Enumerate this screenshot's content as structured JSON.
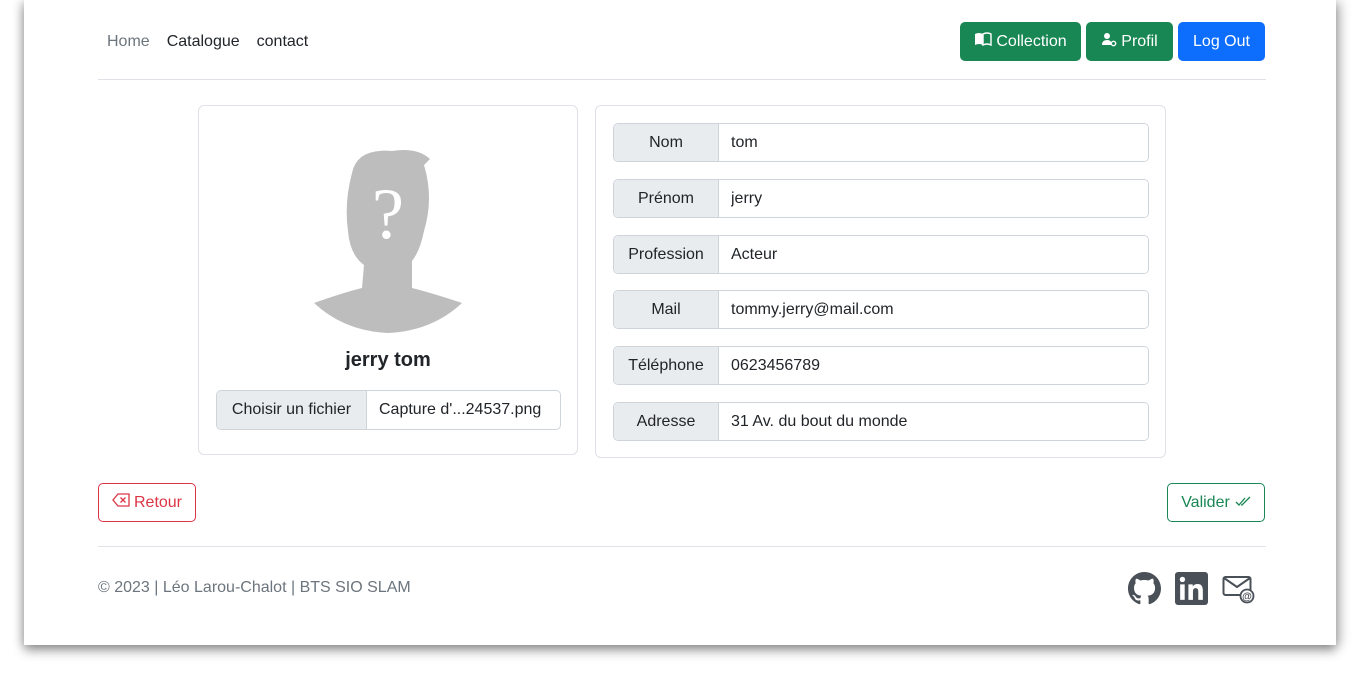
{
  "nav": {
    "links": [
      {
        "label": "Home"
      },
      {
        "label": "Catalogue"
      },
      {
        "label": "contact"
      }
    ],
    "buttons": {
      "collection": "Collection",
      "profil": "Profil",
      "logout": "Log Out"
    }
  },
  "profile": {
    "name": "jerry tom",
    "file_button": "Choisir un fichier",
    "file_name": "Capture d'...24537.png"
  },
  "form": {
    "fields": [
      {
        "label": "Nom",
        "value": "tom"
      },
      {
        "label": "Prénom",
        "value": "jerry"
      },
      {
        "label": "Profession",
        "value": "Acteur"
      },
      {
        "label": "Mail",
        "value": "tommy.jerry@mail.com"
      },
      {
        "label": "Téléphone",
        "value": "0623456789"
      },
      {
        "label": "Adresse",
        "value": "31 Av. du bout du monde"
      }
    ]
  },
  "actions": {
    "retour": "Retour",
    "valider": "Valider"
  },
  "footer": {
    "text": "© 2023 | Léo Larou-Chalot | BTS SIO SLAM",
    "icons": [
      "github-icon",
      "linkedin-icon",
      "mail-icon"
    ]
  },
  "colors": {
    "green": "#198754",
    "blue": "#0d6efd",
    "red": "#dc3545",
    "muted": "#6c757d"
  }
}
